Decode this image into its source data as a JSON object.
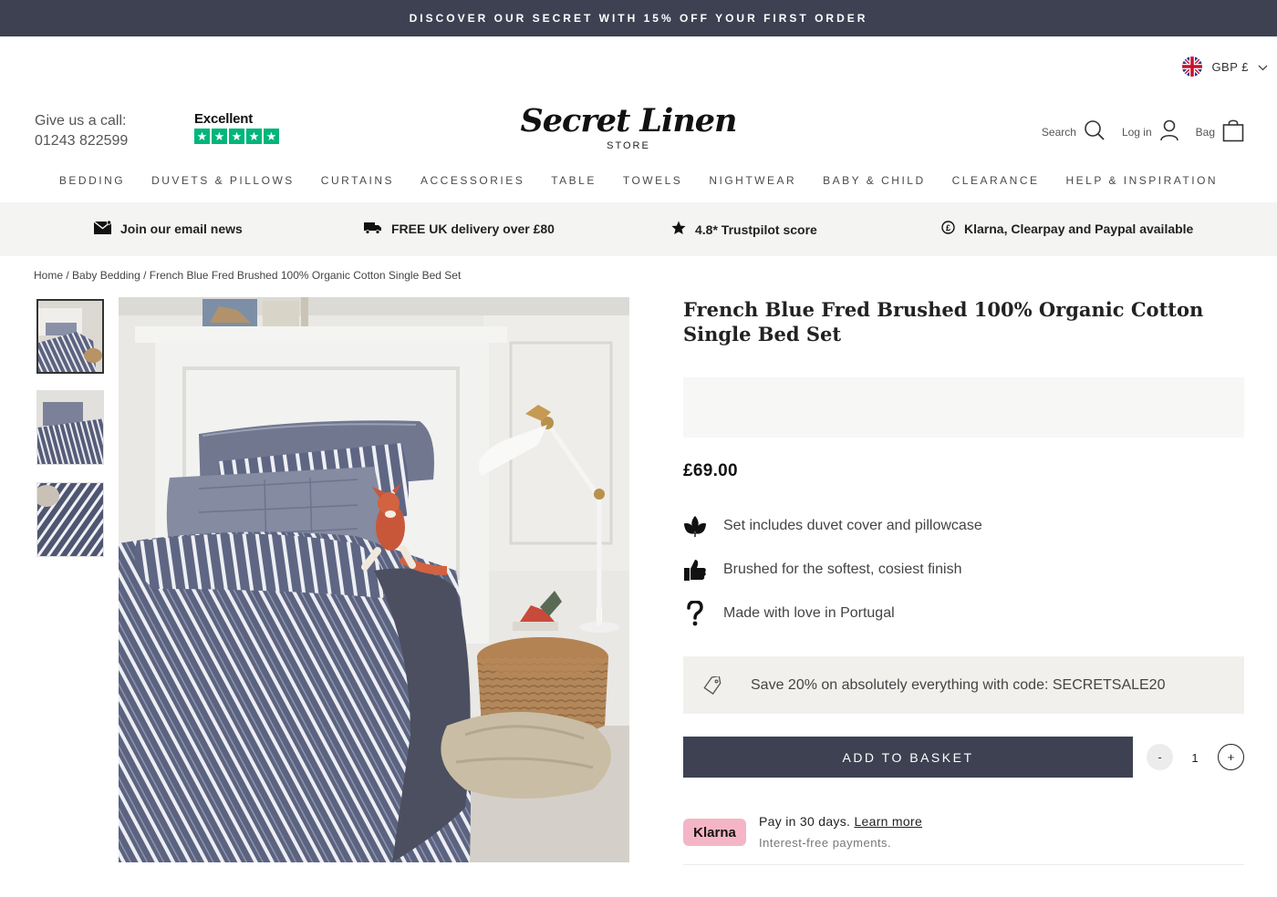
{
  "announcement": "DISCOVER OUR SECRET WITH 15% OFF YOUR FIRST ORDER",
  "currency": {
    "label": "GBP £",
    "flag_icon": "uk-flag-icon"
  },
  "contact": {
    "label": "Give us a call:",
    "phone": "01243 822599"
  },
  "trustpilot": {
    "rating_label": "Excellent",
    "stars": 5,
    "color": "#00b67a"
  },
  "logo": {
    "name": "Secret Linen",
    "subtitle": "STORE"
  },
  "header_tools": {
    "search": "Search",
    "login": "Log in",
    "bag": "Bag"
  },
  "nav": [
    "BEDDING",
    "DUVETS & PILLOWS",
    "CURTAINS",
    "ACCESSORIES",
    "TABLE",
    "TOWELS",
    "NIGHTWEAR",
    "BABY & CHILD",
    "CLEARANCE",
    "HELP & INSPIRATION"
  ],
  "usp": [
    {
      "icon": "envelope-icon",
      "text": "Join our email news"
    },
    {
      "icon": "truck-icon",
      "text": "FREE UK delivery over £80"
    },
    {
      "icon": "star-icon",
      "text": "4.8* Trustpilot score"
    },
    {
      "icon": "pound-icon",
      "text": "Klarna, Clearpay and Paypal available"
    }
  ],
  "breadcrumb": {
    "home": "Home",
    "category": "Baby Bedding",
    "current": "French Blue Fred Brushed 100% Organic Cotton Single Bed Set",
    "separator": " / "
  },
  "product": {
    "title": "French Blue Fred Brushed 100% Organic Cotton Single Bed Set",
    "price": "£69.00",
    "features": [
      {
        "icon": "leaf-icon",
        "text": "Set includes duvet cover and pillowcase"
      },
      {
        "icon": "thumbs-up-icon",
        "text": "Brushed for the softest, cosiest finish"
      },
      {
        "icon": "question-icon",
        "text": "Made with love in Portugal"
      }
    ],
    "promo": {
      "icon": "tag-icon",
      "text": "Save 20% on absolutely everything with code: SECRETSALE20"
    },
    "add_to_basket": "ADD TO BASKET",
    "quantity": {
      "minus": "-",
      "value": "1",
      "plus": "+"
    },
    "klarna": {
      "badge": "Klarna",
      "text": "Pay in 30 days.",
      "link": "Learn more",
      "sub": "Interest-free payments."
    }
  },
  "colors": {
    "brand_dark": "#3d4152",
    "usp_bg": "#f4f4f3",
    "promo_bg": "#f1f0ec",
    "klarna_pink": "#f4b6c7",
    "stripe_blue": "#5b6380"
  }
}
